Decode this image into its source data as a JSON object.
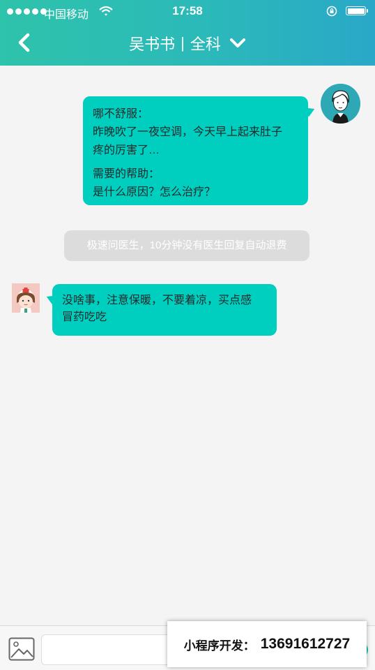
{
  "status_bar": {
    "carrier": "中国移动",
    "time": "17:58"
  },
  "header": {
    "doctor_name": "吴书书",
    "separator": "|",
    "department": "全科"
  },
  "messages": [
    {
      "sender": "patient",
      "lines": [
        "哪不舒服：",
        "昨晚吹了一夜空调，今天早上起来肚子",
        "疼的厉害了…",
        "需要的帮助：",
        "是什么原因？怎么治疗？"
      ]
    },
    {
      "sender": "system",
      "text": "极速问医生，10分钟没有医生回复自动退费"
    },
    {
      "sender": "doctor",
      "lines": [
        "没啥事，注意保暖，不要着凉，买点感",
        "冒药吃吃"
      ]
    }
  ],
  "composer": {
    "input_value": ""
  },
  "promo": {
    "label": "小程序开发：",
    "phone": "13691612727"
  },
  "colors": {
    "header_gradient_start": "#2ec3ab",
    "header_gradient_end": "#2aa8c8",
    "bubble": "#00cfc0",
    "system_bubble": "#dcdcdc",
    "background": "#f4f4f4"
  },
  "icons": {
    "back": "chevron-left-icon",
    "dropdown": "chevron-down-icon",
    "image": "image-icon",
    "wifi": "wifi-icon",
    "orientation_lock": "orientation-lock-icon",
    "battery": "battery-icon"
  }
}
